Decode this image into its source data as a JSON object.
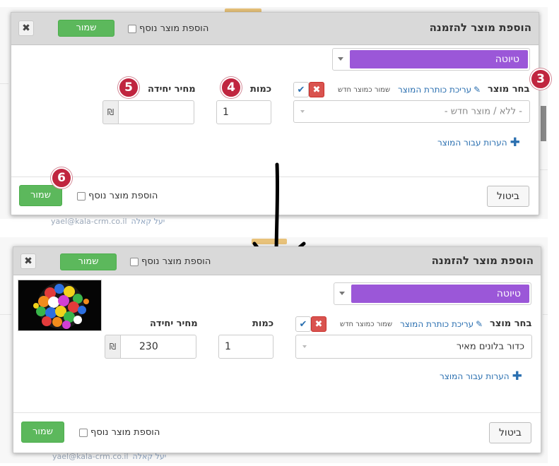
{
  "top_dialog": {
    "title": "הוספת מוצר להזמנה",
    "save_label": "שמור",
    "add_another_label": "הוספת מוצר נוסף",
    "status_value": "טיוטה",
    "product_label": "בחר מוצר",
    "edit_product_link": "עריכת כותרת המוצר",
    "save_as_new_label": "שמור כמוצר חדש",
    "product_placeholder": "- ללא / מוצר חדש -",
    "quantity_label": "כמות",
    "quantity_value": "1",
    "unit_price_label": "מחיר יחידה",
    "unit_price_value": "",
    "currency_symbol": "₪",
    "notes_link": "הערות עבור המוצר",
    "cancel_label": "ביטול",
    "footer_add_another_label": "הוספת מוצר נוסף",
    "footer_save_label": "שמור"
  },
  "bottom_dialog": {
    "title": "הוספת מוצר להזמנה",
    "save_label": "שמור",
    "add_another_label": "הוספת מוצר נוסף",
    "status_value": "טיוטה",
    "product_label": "בחר מוצר",
    "edit_product_link": "עריכת כותרת המוצר",
    "save_as_new_label": "שמור כמוצר חדש",
    "product_value": "כדור בלונים מאיר",
    "quantity_label": "כמות",
    "quantity_value": "1",
    "unit_price_label": "מחיר יחידה",
    "unit_price_value": "230",
    "currency_symbol": "₪",
    "notes_link": "הערות עבור המוצר",
    "cancel_label": "ביטול",
    "footer_add_another_label": "הוספת מוצר נוסף",
    "footer_save_label": "שמור"
  },
  "annotations": {
    "step_3": "3",
    "step_4": "4",
    "step_5": "5",
    "step_6": "6"
  },
  "background": {
    "email_top": "yael@kala-crm.co.il",
    "name_top": "יעל קאלה",
    "email_bottom": "yael@kala-crm.co.il",
    "name_bottom": "יעל קאלה"
  },
  "colors": {
    "status_purple": "#9b57d8",
    "save_green": "#5cb85c",
    "badge_red": "#c0253f",
    "link_blue": "#2a6fb0"
  },
  "icons": {
    "close": "close-icon",
    "pencil": "pencil-icon",
    "check": "check-icon",
    "cancel": "x-icon",
    "plus": "plus-icon",
    "arrow": "arrow-down-icon"
  }
}
